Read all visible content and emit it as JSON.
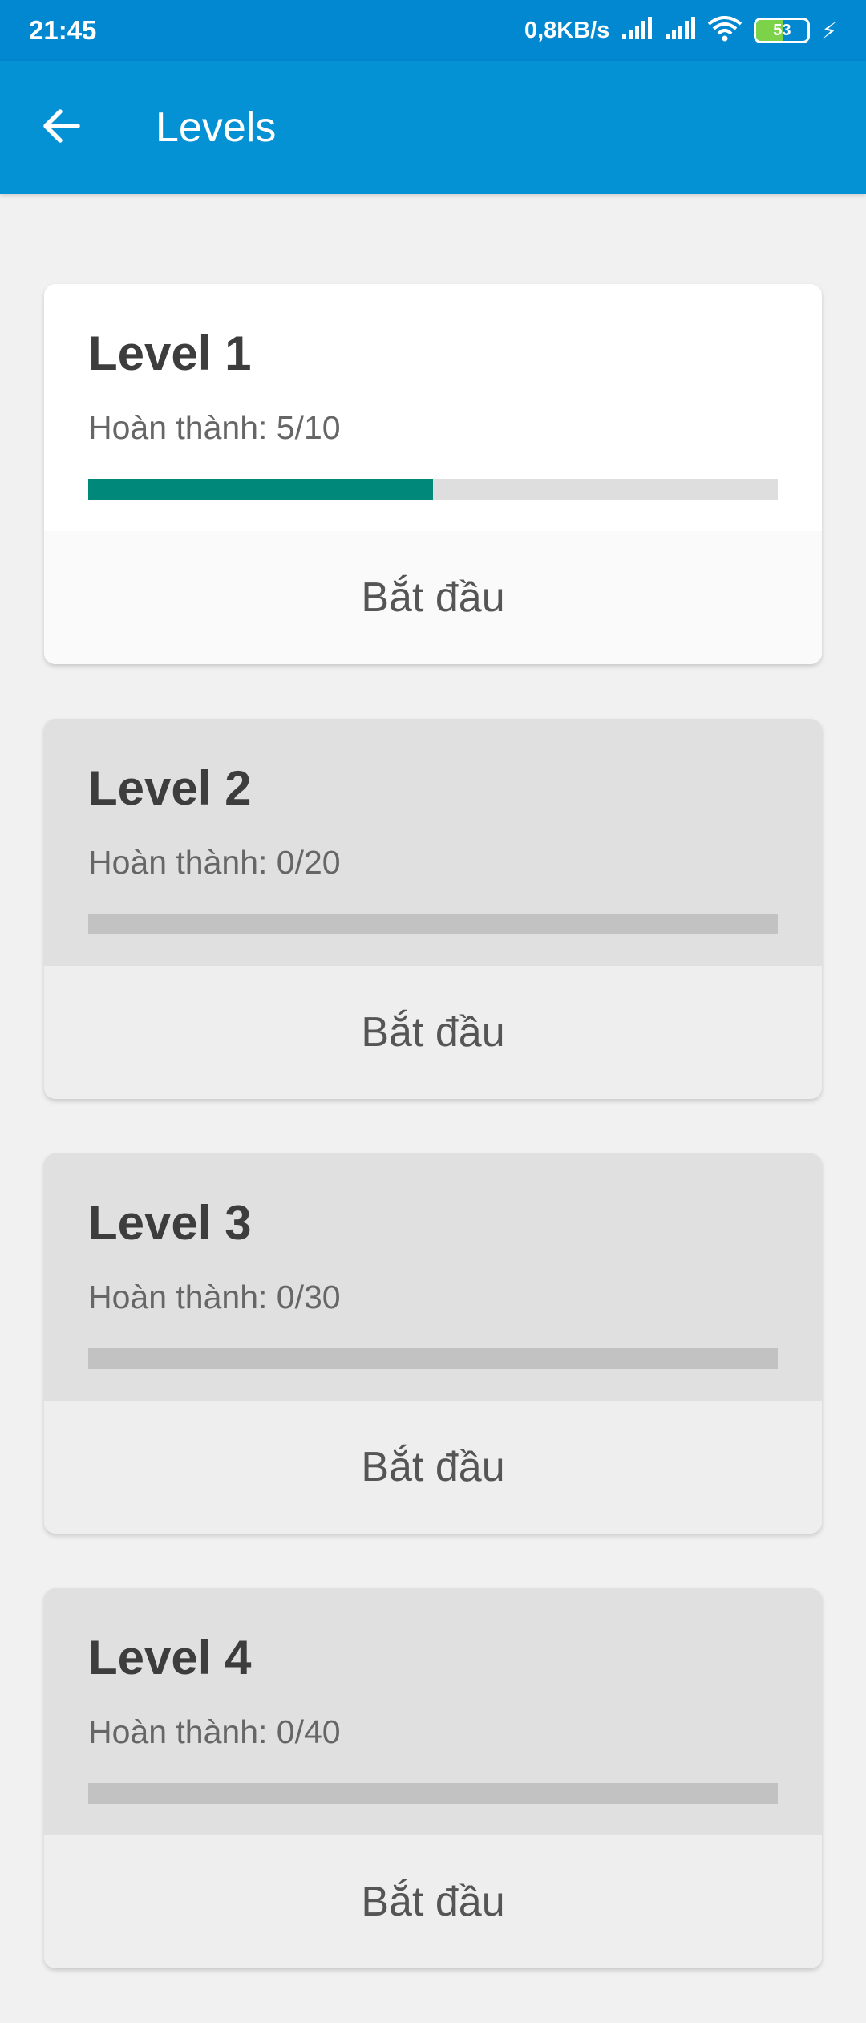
{
  "status_bar": {
    "time": "21:45",
    "net_speed": "0,8KB/s",
    "battery": "53",
    "battery_level": 0.53,
    "icons": [
      "signal-icon",
      "signal-icon",
      "wifi-icon",
      "battery-icon",
      "charging-icon"
    ]
  },
  "app_bar": {
    "title": "Levels",
    "back_icon": "arrow-left-icon"
  },
  "colors": {
    "status_bar": "#0288d1",
    "app_bar": "#0592d4",
    "progress": "#00897b"
  },
  "levels": [
    {
      "title": "Level 1",
      "progress_text": "Hoàn thành: 5/10",
      "completed": 5,
      "total": 10,
      "action": "Bắt đầu",
      "active": true
    },
    {
      "title": "Level 2",
      "progress_text": "Hoàn thành: 0/20",
      "completed": 0,
      "total": 20,
      "action": "Bắt đầu",
      "active": false
    },
    {
      "title": "Level 3",
      "progress_text": "Hoàn thành: 0/30",
      "completed": 0,
      "total": 30,
      "action": "Bắt đầu",
      "active": false
    },
    {
      "title": "Level 4",
      "progress_text": "Hoàn thành: 0/40",
      "completed": 0,
      "total": 40,
      "action": "Bắt đầu",
      "active": false
    }
  ]
}
